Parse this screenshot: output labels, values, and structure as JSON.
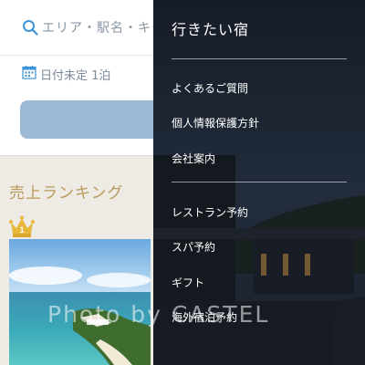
{
  "search": {
    "area_placeholder": "エリア・駅名・キー",
    "date_value": "日付未定 1泊"
  },
  "ranking": {
    "title": "売上ランキング",
    "rank_number": "1"
  },
  "watermark": "Photo by CASTEL",
  "menu": {
    "title": "行きたい宿",
    "group1": [
      "よくあるご質問",
      "個人情報保護方針",
      "会社案内"
    ],
    "group2": [
      "レストラン予約",
      "スパ予約",
      "ギフト",
      "海外宿泊予約"
    ]
  },
  "colors": {
    "ranking_gold": "#b99a5a",
    "search_button": "#9db9d6",
    "overlay": "#262b33"
  },
  "icons": {
    "search": "search-icon",
    "calendar": "calendar-icon",
    "crown": "crown-icon"
  }
}
